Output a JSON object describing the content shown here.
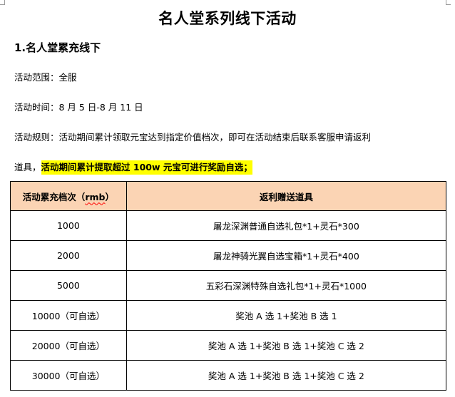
{
  "document": {
    "title": "名人堂系列线下活动",
    "section_heading": "1.名人堂累充线下",
    "scope": "活动范围：全服",
    "time": "活动时间：8 月 5 日-8 月 11 日",
    "rules_line1": "活动规则：活动期间累计领取元宝达到指定价值档次，即可在活动结束后联系客服申请返利",
    "rules_line2_prefix": "道具，",
    "rules_line2_highlight": "活动期间累计提取超过 100w 元宝可进行奖励自选；",
    "highlight_color": "#ffff00",
    "header_fill_color": "#fbd4b4"
  },
  "table": {
    "headers": {
      "tier_prefix": "活动累充档次（",
      "tier_unit": "rmb",
      "tier_suffix": "）",
      "reward": "返利赠送道具"
    },
    "rows": [
      {
        "tier": "1000",
        "reward": "屠龙深渊普通自选礼包*1+灵石*300"
      },
      {
        "tier": "2000",
        "reward": "屠龙神骑光翼自选宝箱*1+灵石*400"
      },
      {
        "tier": "5000",
        "reward": "五彩石深渊特殊自选礼包*1+灵石*1000"
      },
      {
        "tier": "10000（可自选）",
        "reward": "奖池 A 选 1+奖池 B 选 1"
      },
      {
        "tier": "20000（可自选）",
        "reward": "奖池 A 选 1+奖池 B 选 1+奖池 C 选 2"
      },
      {
        "tier": "30000（可自选）",
        "reward": "奖池 A 选 1+奖池 B 选 1+奖池 C 选 2"
      }
    ]
  }
}
